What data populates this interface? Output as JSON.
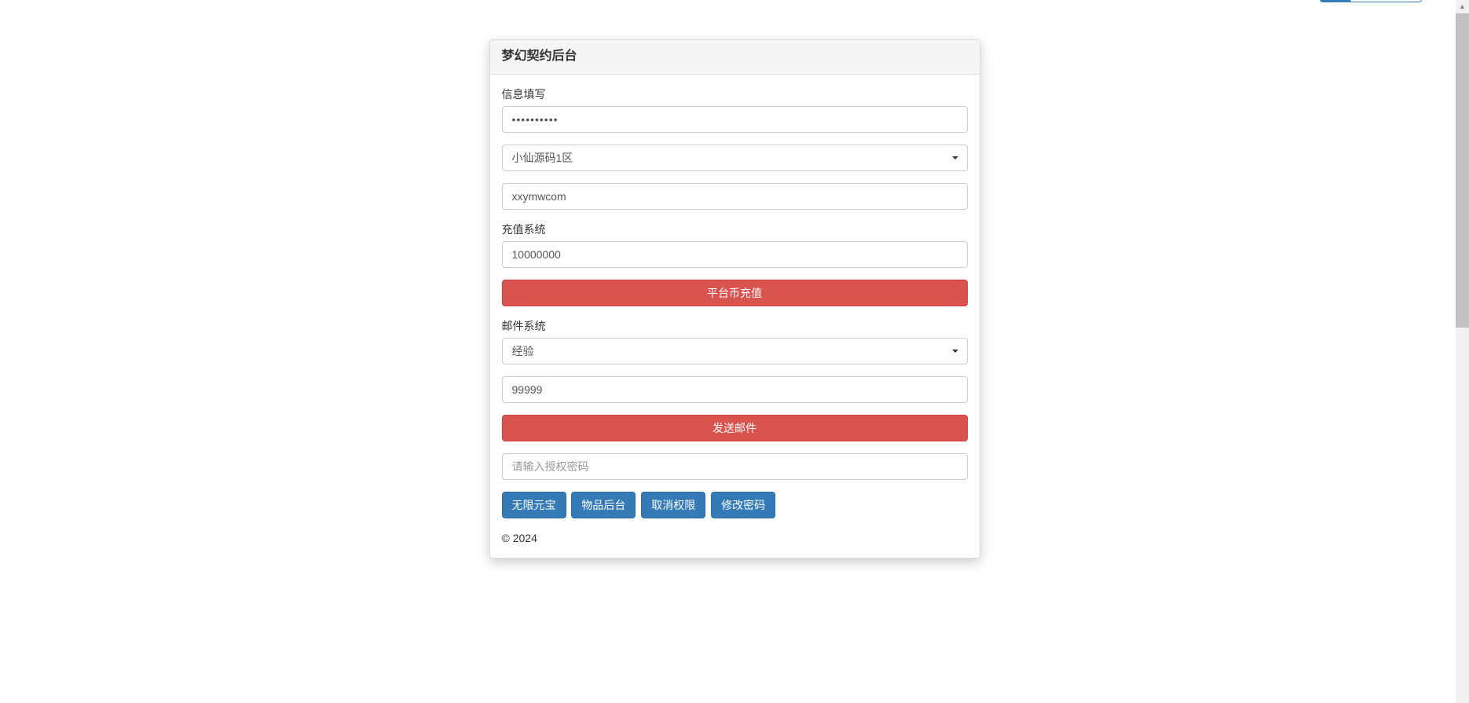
{
  "panel": {
    "title": "梦幻契约后台"
  },
  "info_section": {
    "label": "信息填写",
    "password_value": "**********",
    "server_value": "小仙源码1区",
    "username_value": "xxymwcom"
  },
  "recharge_section": {
    "label": "充值系统",
    "amount_value": "10000000",
    "button_label": "平台币充值"
  },
  "mail_section": {
    "label": "邮件系统",
    "item_value": "经验",
    "quantity_value": "99999",
    "button_label": "发送邮件"
  },
  "auth_section": {
    "placeholder": "请输入授权密码"
  },
  "buttons": {
    "unlimited_gold": "无限元宝",
    "item_backend": "物品后台",
    "cancel_auth": "取消权限",
    "change_password": "修改密码"
  },
  "footer": {
    "copyright": "© 2024"
  }
}
